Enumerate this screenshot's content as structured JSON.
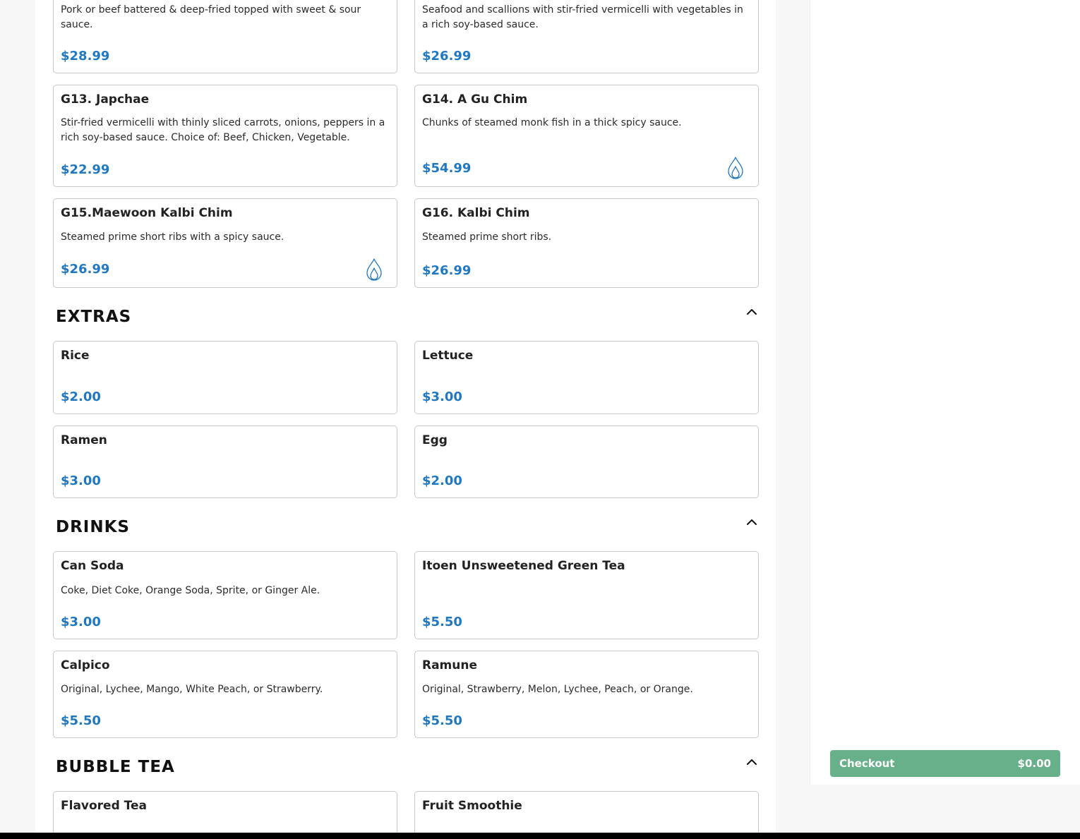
{
  "sections": {
    "top": {
      "cards": [
        {
          "desc": "Pork or beef battered & deep-fried topped with sweet & sour sauce.",
          "price": "$28.99"
        },
        {
          "desc": "Seafood and scallions with stir-fried vermicelli with vegetables in a rich soy-based sauce.",
          "price": "$26.99"
        },
        {
          "name": "G13. Japchae",
          "desc": "Stir-fried vermicelli with thinly sliced carrots, onions, peppers in a rich soy-based sauce. Choice of: Beef, Chicken, Vegetable.",
          "price": "$22.99"
        },
        {
          "name": "G14. A Gu Chim",
          "desc": "Chunks of steamed monk fish in a thick spicy sauce.",
          "price": "$54.99",
          "icon": "spicy-flame-icon"
        },
        {
          "name": "G15.Maewoon Kalbi Chim",
          "desc": "Steamed prime short ribs with a spicy sauce.",
          "price": "$26.99",
          "icon": "spicy-flame-icon"
        },
        {
          "name": "G16. Kalbi Chim",
          "desc": "Steamed prime short ribs.",
          "price": "$26.99"
        }
      ]
    },
    "extras": {
      "title": "EXTRAS",
      "cards": [
        {
          "name": "Rice",
          "price": "$2.00"
        },
        {
          "name": "Lettuce",
          "price": "$3.00"
        },
        {
          "name": "Ramen",
          "price": "$3.00"
        },
        {
          "name": "Egg",
          "price": "$2.00"
        }
      ]
    },
    "drinks": {
      "title": "DRINKS",
      "cards": [
        {
          "name": "Can Soda",
          "desc": "Coke, Diet Coke, Orange Soda, Sprite, or Ginger Ale.",
          "price": "$3.00"
        },
        {
          "name": "Itoen Unsweetened Green Tea",
          "price": "$5.50"
        },
        {
          "name": "Calpico",
          "desc": "Original, Lychee, Mango, White Peach, or Strawberry.",
          "price": "$5.50"
        },
        {
          "name": "Ramune",
          "desc": "Original, Strawberry, Melon, Lychee, Peach, or Orange.",
          "price": "$5.50"
        }
      ]
    },
    "bubble_tea": {
      "title": "BUBBLE TEA",
      "cards": [
        {
          "name": "Flavored Tea"
        },
        {
          "name": "Fruit Smoothie"
        }
      ]
    }
  },
  "checkout": {
    "label": "Checkout",
    "total": "$0.00"
  },
  "icons": {
    "section_toggle": "chevron-up-icon",
    "spicy": "spicy-flame-icon"
  },
  "colors": {
    "price": "#2078c0",
    "checkout_bg": "#68b08a"
  }
}
